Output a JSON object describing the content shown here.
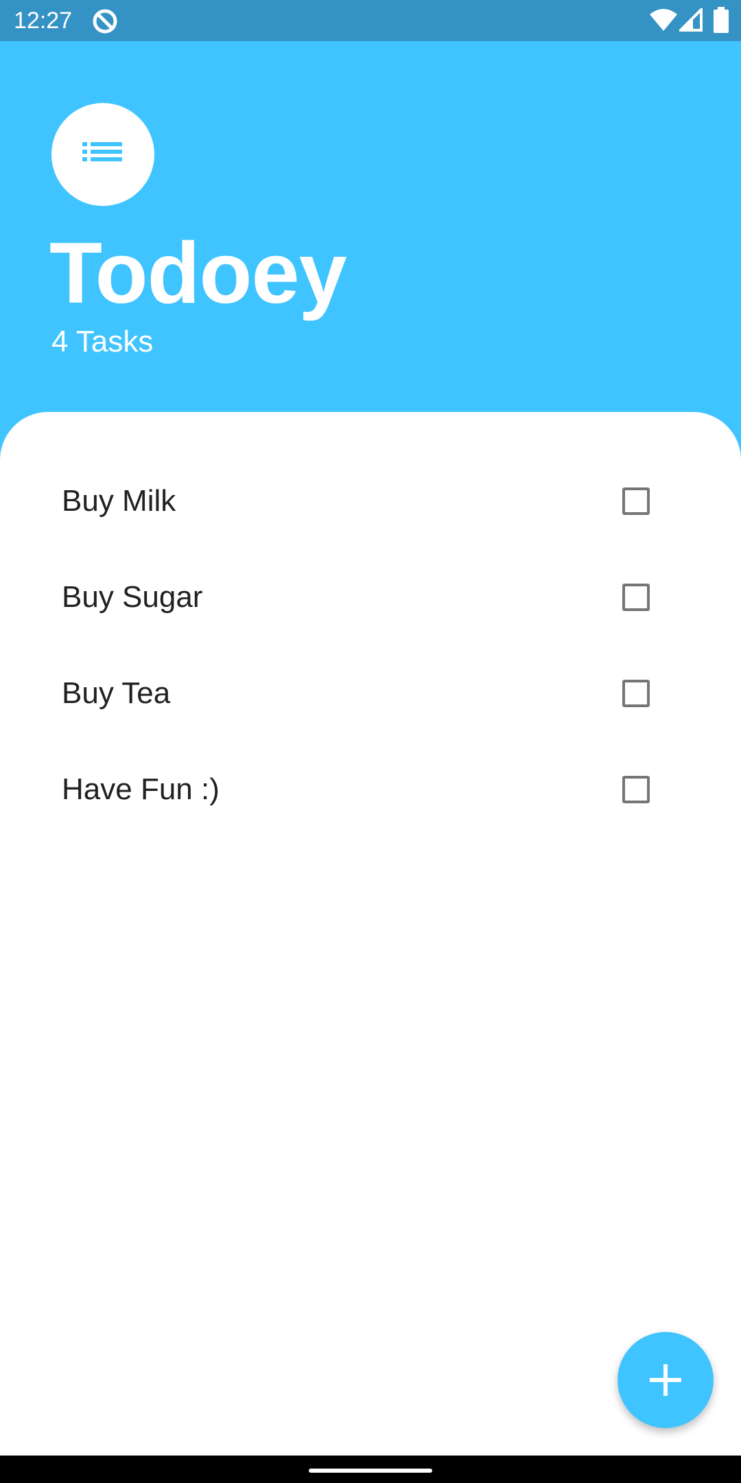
{
  "status_bar": {
    "time": "12:27",
    "icons": [
      "app-notification-icon",
      "wifi-icon",
      "cell-signal-icon",
      "battery-icon"
    ]
  },
  "header": {
    "icon": "list-icon",
    "title": "Todoey",
    "task_count": "4 Tasks"
  },
  "tasks": [
    {
      "label": "Buy Milk",
      "checked": false
    },
    {
      "label": "Buy Sugar",
      "checked": false
    },
    {
      "label": "Buy Tea",
      "checked": false
    },
    {
      "label": "Have Fun :)",
      "checked": false
    }
  ],
  "fab": {
    "icon": "add-icon"
  },
  "colors": {
    "accent": "#40C4FF",
    "status_bar": "#3592C4",
    "checkbox_border": "#757575",
    "task_text": "#212121"
  }
}
